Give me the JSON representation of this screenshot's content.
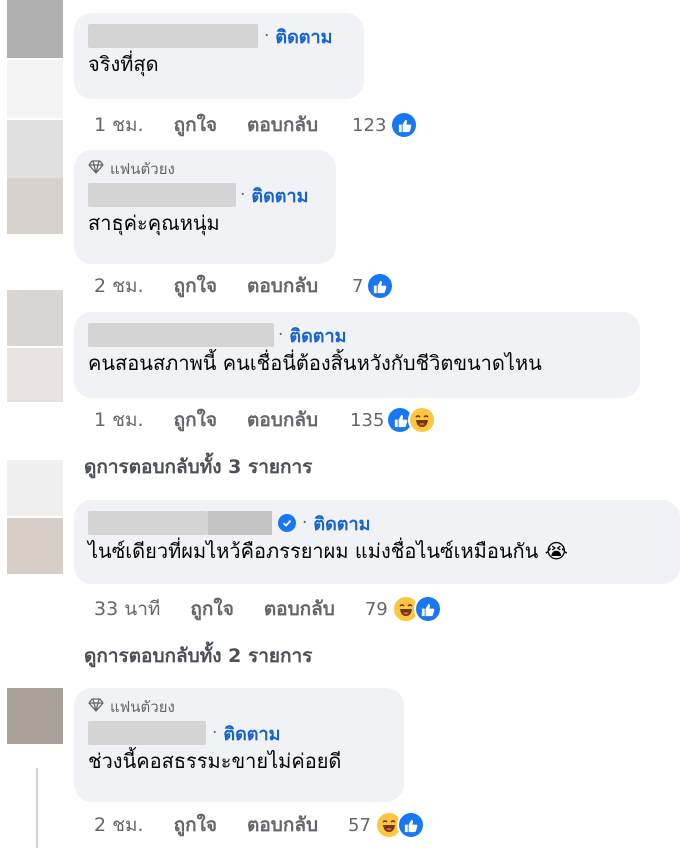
{
  "comments": [
    {
      "text": "จริงที่สุด",
      "follow": "ติดตาม",
      "time": "1 ชม.",
      "like": "ถูกใจ",
      "reply": "ตอบกลับ",
      "count": "123",
      "reactions": [
        "like"
      ]
    },
    {
      "badge": "แฟนตัวยง",
      "text": "สาธุค่ะคุณหนุ่ม",
      "follow": "ติดตาม",
      "time": "2 ชม.",
      "like": "ถูกใจ",
      "reply": "ตอบกลับ",
      "count": "7",
      "reactions": [
        "like"
      ]
    },
    {
      "text": "คนสอนสภาพนี้ คนเชื่อนี่ต้องสิ้นหวังกับชีวิตขนาดไหน",
      "follow": "ติดตาม",
      "time": "1 ชม.",
      "like": "ถูกใจ",
      "reply": "ตอบกลับ",
      "count": "135",
      "reactions": [
        "like",
        "haha"
      ],
      "more_replies": "ดูการตอบกลับทั้ง 3 รายการ"
    },
    {
      "text": "ไนซ์เดียวที่ผมไหว้คือภรรยาผม แม่งชื่อไนซ์เหมือนกัน 😭",
      "follow": "ติดตาม",
      "verified": true,
      "time": "33 นาที",
      "like": "ถูกใจ",
      "reply": "ตอบกลับ",
      "count": "79",
      "reactions": [
        "haha",
        "like"
      ],
      "more_replies": "ดูการตอบกลับทั้ง 2 รายการ"
    },
    {
      "badge": "แฟนตัวยง",
      "text": "ช่วงนี้คอสธรรมะขายไม่ค่อยดี",
      "follow": "ติดตาม",
      "time": "2 ชม.",
      "like": "ถูกใจ",
      "reply": "ตอบกลับ",
      "count": "57",
      "reactions": [
        "haha",
        "like"
      ]
    }
  ],
  "colors": {
    "bubble": "#f0f2f5",
    "follow": "#1763cf",
    "like_react": "#1877f2",
    "haha_react": "#fcc63f",
    "meta": "#65676b"
  },
  "icons": {
    "badge": "diamond-icon",
    "like": "thumbs-up-icon",
    "haha": "laughing-face-icon",
    "verified": "verified-check-icon"
  }
}
